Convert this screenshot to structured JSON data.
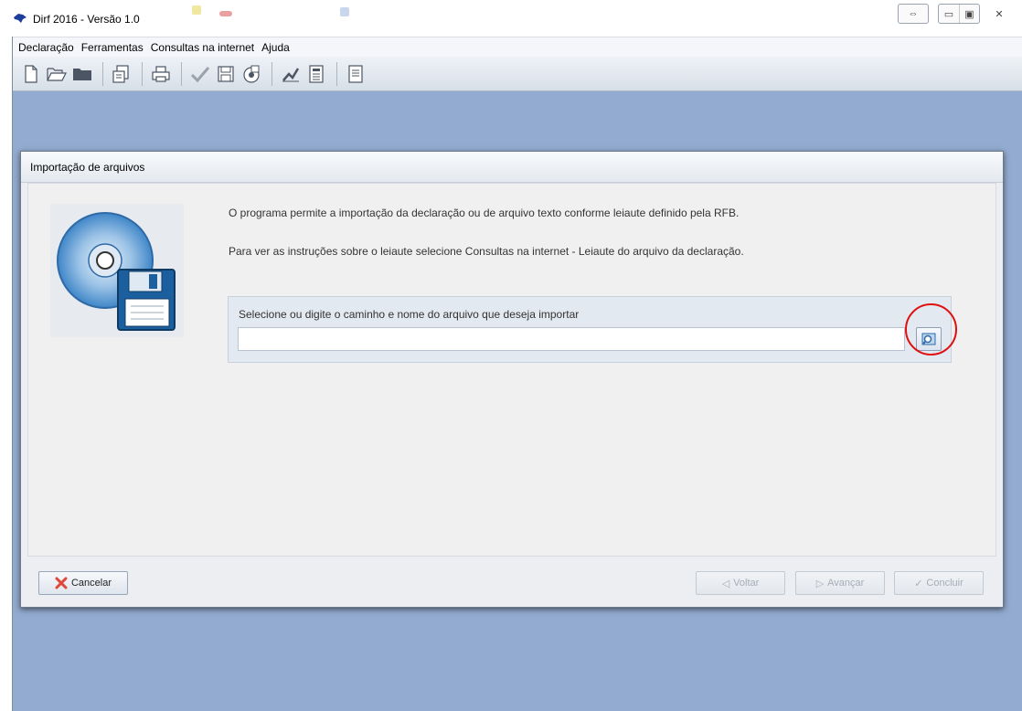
{
  "window": {
    "title": "Dirf 2016 - Versão 1.0",
    "icon": "brazil-map-icon",
    "buttons": [
      "restore-swap-icon",
      "minimize-icon",
      "maximize-icon",
      "close-icon"
    ]
  },
  "menu": {
    "items": [
      {
        "label": "Declaração"
      },
      {
        "label": "Ferramentas"
      },
      {
        "label": "Consultas na internet"
      },
      {
        "label": "Ajuda"
      }
    ]
  },
  "toolbar": {
    "icons": [
      "new-document-icon",
      "open-folder-icon",
      "folder-icon",
      "copy-document-icon",
      "print-icon",
      "verify-check-icon",
      "save-icon",
      "transmit-icon",
      "signature-icon",
      "calculator-icon",
      "report-icon"
    ]
  },
  "dialog": {
    "title": "Importação de arquivos",
    "description_1": "O programa permite a importação da declaração ou de arquivo texto conforme leiaute definido pela RFB.",
    "description_2": "Para ver as instruções sobre o leiaute selecione Consultas na internet - Leiaute do arquivo da declaração.",
    "file_label": "Selecione ou digite o caminho e nome do arquivo que deseja importar",
    "file_value": "",
    "buttons": {
      "cancel": "Cancelar",
      "back": "Voltar",
      "next": "Avançar",
      "finish": "Concluir"
    }
  },
  "colors": {
    "workspace": "#93abd0",
    "highlight": "#e01010",
    "cancel_icon": "#e0473a"
  }
}
